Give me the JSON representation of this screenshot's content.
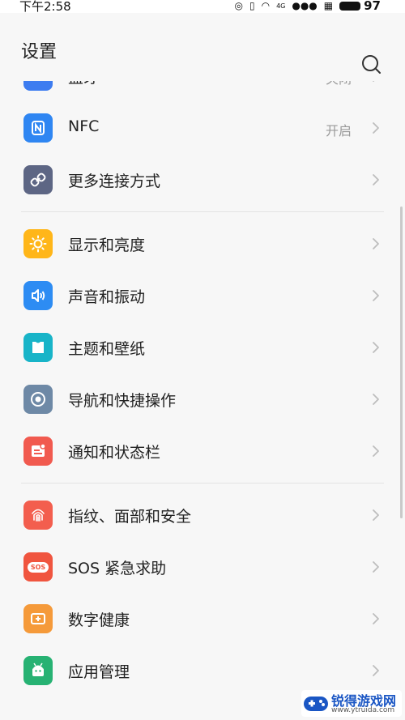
{
  "status_bar": {
    "time": "下午2:58",
    "network": "4G",
    "battery": "97"
  },
  "header": {
    "title": "设置",
    "search_icon": "search-icon"
  },
  "settings": [
    {
      "label": "蓝牙",
      "value": "关闭",
      "icon": "bluetooth-icon",
      "color": "#3d7cf0"
    },
    {
      "label": "NFC",
      "value": "开启",
      "icon": "nfc-icon",
      "color": "#2f86f2"
    },
    {
      "label": "更多连接方式",
      "value": "",
      "icon": "link-icon",
      "color": "#5d6684"
    },
    {
      "label": "显示和亮度",
      "value": "",
      "icon": "sun-icon",
      "color": "#ffb619"
    },
    {
      "label": "声音和振动",
      "value": "",
      "icon": "speaker-icon",
      "color": "#2d8cf3"
    },
    {
      "label": "主题和壁纸",
      "value": "",
      "icon": "theme-shirt-icon",
      "color": "#18b4c8"
    },
    {
      "label": "导航和快捷操作",
      "value": "",
      "icon": "navigation-icon",
      "color": "#6e89a6"
    },
    {
      "label": "通知和状态栏",
      "value": "",
      "icon": "notification-icon",
      "color": "#f15a4f"
    },
    {
      "label": "指纹、面部和安全",
      "value": "",
      "icon": "fingerprint-icon",
      "color": "#f35e4e"
    },
    {
      "label": "SOS 紧急求助",
      "value": "",
      "icon": "sos-icon",
      "color": "#f0553f",
      "icon_text": "SOS"
    },
    {
      "label": "数字健康",
      "value": "",
      "icon": "digital-health-icon",
      "color": "#f59a3a"
    },
    {
      "label": "应用管理",
      "value": "",
      "icon": "android-app-icon",
      "color": "#27b273"
    }
  ],
  "watermark": {
    "text": "锐得游戏网",
    "url": "www.ytruida.com"
  }
}
